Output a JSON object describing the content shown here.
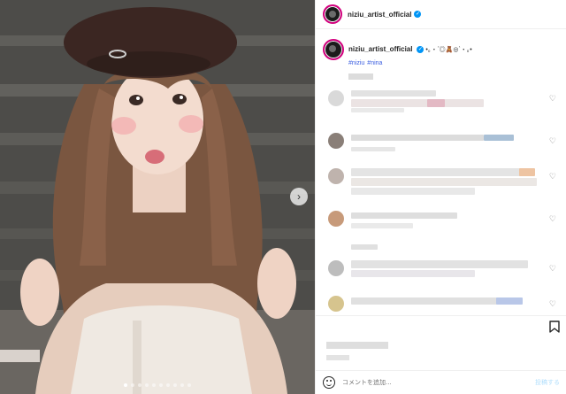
{
  "post": {
    "username": "niziu_artist_official",
    "verified_icon": "verified-badge-icon",
    "caption_text": "•｡・ˊ◎🧸◎ˋ・｡•",
    "hashtags": [
      "#niziu",
      "#nina"
    ]
  },
  "media": {
    "next_icon": "chevron-right-icon",
    "dot_count": 10,
    "active_dot": 0
  },
  "composer": {
    "placeholder": "コメントを追加...",
    "post_label": "投稿する"
  },
  "colors": {
    "accent": "#0095f6",
    "hashtag": "#3b5ee0",
    "story_ring": "#d3007e"
  }
}
